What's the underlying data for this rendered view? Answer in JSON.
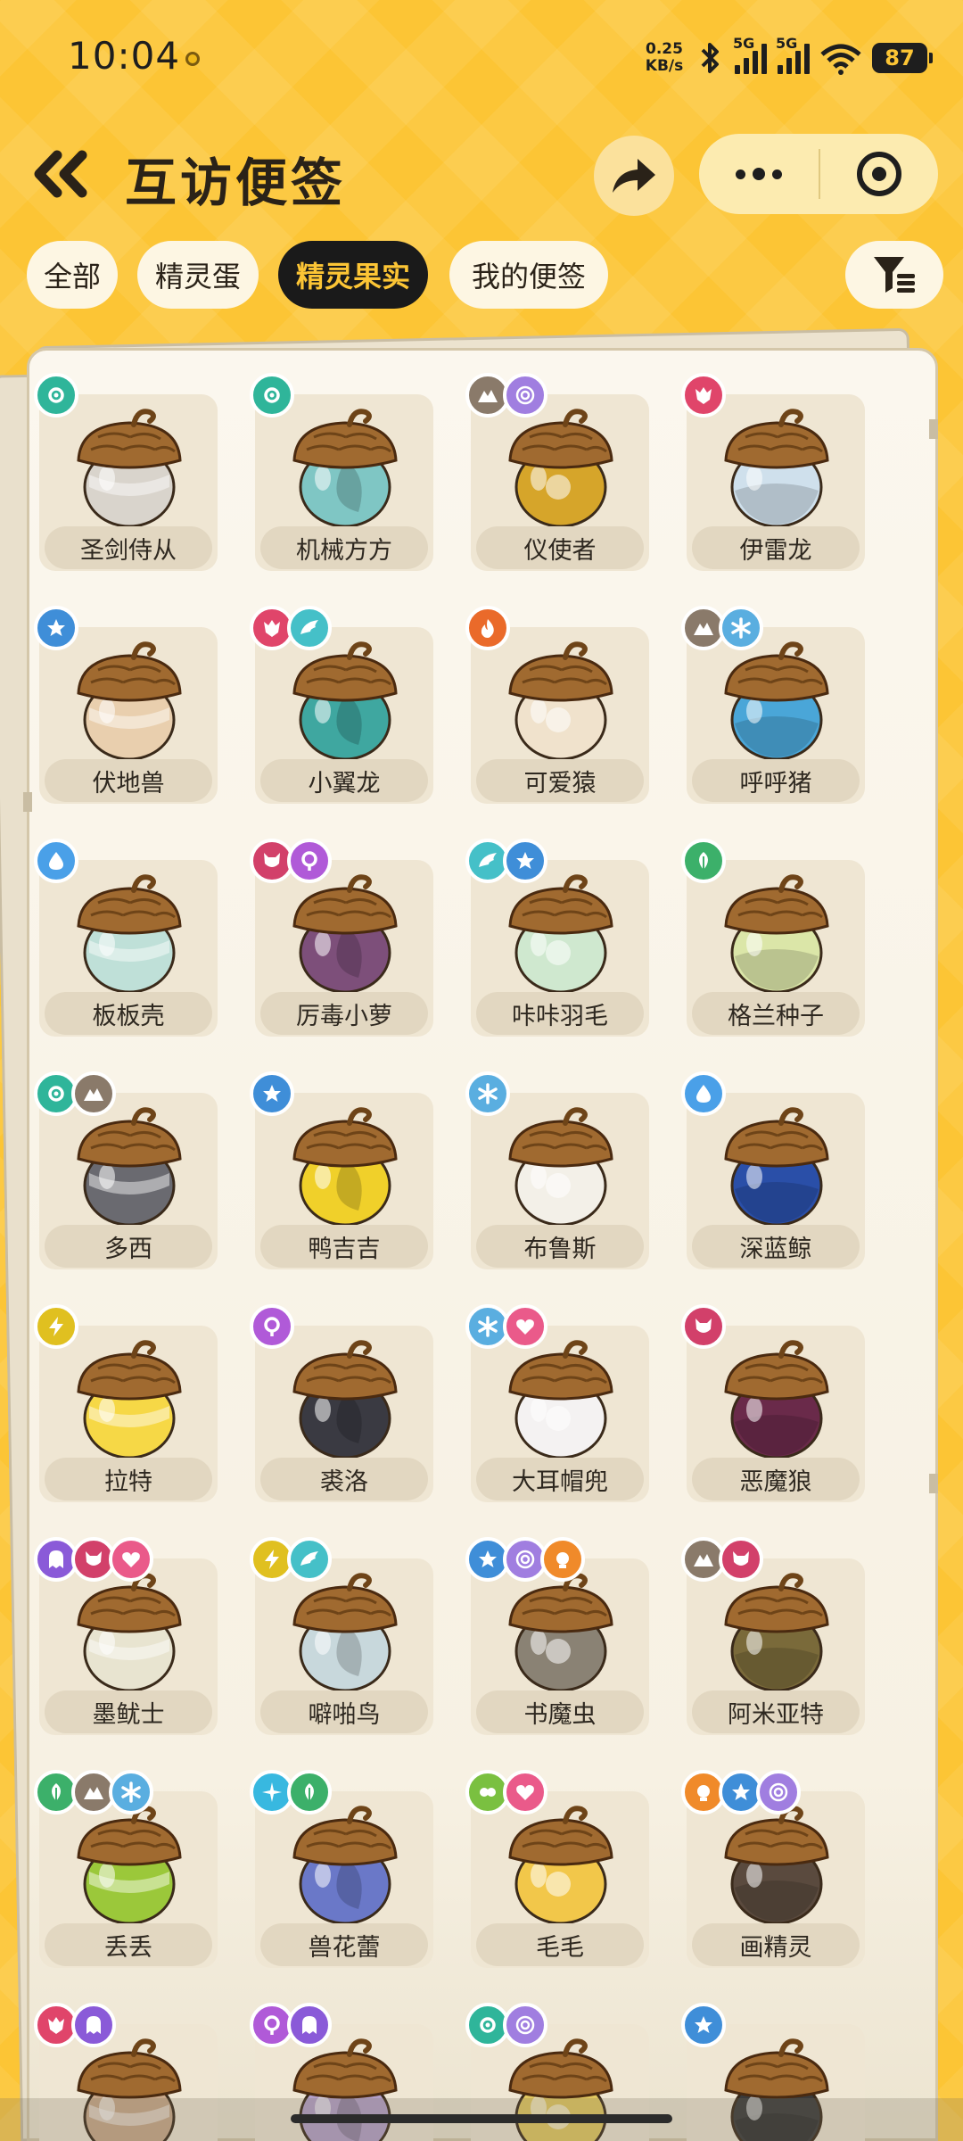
{
  "status": {
    "time": "10:04",
    "speed_value": "0.25",
    "speed_unit": "KB/s",
    "sim1": "5G",
    "sim2": "5G",
    "battery": "87"
  },
  "header": {
    "title": "互访便签"
  },
  "tabs": [
    {
      "label": "全部",
      "active": false
    },
    {
      "label": "精灵蛋",
      "active": false
    },
    {
      "label": "精灵果实",
      "active": true
    },
    {
      "label": "我的便签",
      "active": false
    }
  ],
  "colors": {
    "background": "#fcc535",
    "tab_active_bg": "#1a1a1a",
    "tab_active_text": "#fcc535"
  },
  "items": [
    {
      "name": "圣剑侍从",
      "types": [
        "machine"
      ]
    },
    {
      "name": "机械方方",
      "types": [
        "machine"
      ]
    },
    {
      "name": "仪使者",
      "types": [
        "earth",
        "spirit"
      ]
    },
    {
      "name": "伊雷龙",
      "types": [
        "dragon"
      ]
    },
    {
      "name": "伏地兽",
      "types": [
        "normal"
      ]
    },
    {
      "name": "小翼龙",
      "types": [
        "dragon",
        "wing"
      ]
    },
    {
      "name": "可爱猿",
      "types": [
        "fire"
      ]
    },
    {
      "name": "呼呼猪",
      "types": [
        "earth",
        "ice"
      ]
    },
    {
      "name": "板板壳",
      "types": [
        "water"
      ]
    },
    {
      "name": "厉毒小萝",
      "types": [
        "demon",
        "poison"
      ]
    },
    {
      "name": "咔咔羽毛",
      "types": [
        "wing",
        "normal"
      ]
    },
    {
      "name": "格兰种子",
      "types": [
        "grass"
      ]
    },
    {
      "name": "多西",
      "types": [
        "machine",
        "earth"
      ]
    },
    {
      "name": "鸭吉吉",
      "types": [
        "normal"
      ]
    },
    {
      "name": "布鲁斯",
      "types": [
        "ice"
      ]
    },
    {
      "name": "深蓝鲸",
      "types": [
        "water"
      ]
    },
    {
      "name": "拉特",
      "types": [
        "electric"
      ]
    },
    {
      "name": "裘洛",
      "types": [
        "poison"
      ]
    },
    {
      "name": "大耳帽兜",
      "types": [
        "ice",
        "cute"
      ]
    },
    {
      "name": "恶魔狼",
      "types": [
        "demon"
      ]
    },
    {
      "name": "墨鱿士",
      "types": [
        "ghost",
        "demon",
        "cute"
      ]
    },
    {
      "name": "噼啪鸟",
      "types": [
        "electric",
        "wing"
      ]
    },
    {
      "name": "书魔虫",
      "types": [
        "normal",
        "spirit",
        "light"
      ]
    },
    {
      "name": "阿米亚特",
      "types": [
        "earth",
        "demon"
      ]
    },
    {
      "name": "丢丢",
      "types": [
        "grass",
        "earth",
        "ice"
      ]
    },
    {
      "name": "兽花蕾",
      "types": [
        "star",
        "grass"
      ]
    },
    {
      "name": "毛毛",
      "types": [
        "bug",
        "cute"
      ]
    },
    {
      "name": "画精灵",
      "types": [
        "light",
        "normal",
        "spirit"
      ]
    },
    {
      "name": "",
      "types": [
        "dragon",
        "ghost"
      ]
    },
    {
      "name": "",
      "types": [
        "poison",
        "ghost"
      ]
    },
    {
      "name": "",
      "types": [
        "machine",
        "spirit"
      ]
    },
    {
      "name": "",
      "types": [
        "normal"
      ]
    }
  ],
  "acorn_body_colors": [
    "#d9d4cc",
    "#7fc6c4",
    "#d6a52a",
    "#cfe0ec",
    "#e9cfae",
    "#3fa7a0",
    "#f0e2cc",
    "#4aa6d8",
    "#bfe0d8",
    "#7d4f7a",
    "#cfe8cf",
    "#dbe6a8",
    "#6a6a70",
    "#f0d02a",
    "#f3f0e8",
    "#2a4fa8",
    "#f6d846",
    "#3a3a42",
    "#f4f2f2",
    "#6a2a4a",
    "#e8e4d0",
    "#c8d8dc",
    "#8a8274",
    "#7a6a3a",
    "#9bc83a",
    "#6a78c8",
    "#f2c74a",
    "#5a4a3e",
    "#c8a88a",
    "#b4a0c8",
    "#e2c860",
    "#3a3a3a"
  ]
}
